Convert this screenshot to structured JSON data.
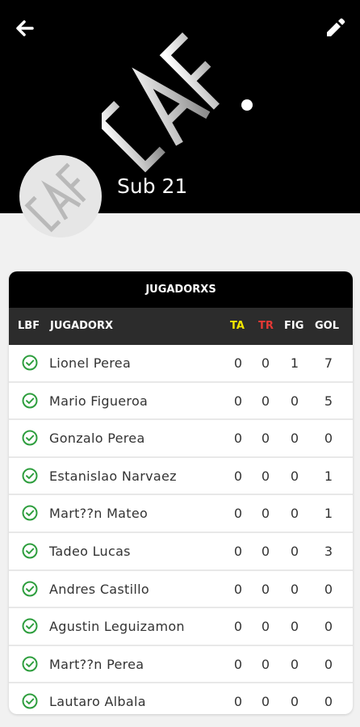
{
  "header": {
    "back_icon": "arrow-left-icon",
    "edit_icon": "pencil-icon",
    "team_name": "Sub 21",
    "logo_icon": "team-logo-icon"
  },
  "table": {
    "title": "JUGADORXS",
    "columns": {
      "lbf": "LBF",
      "player": "JUGADORX",
      "ta": "TA",
      "tr": "TR",
      "fig": "FIG",
      "gol": "GOL"
    },
    "colors": {
      "ta": "#f2e600",
      "tr": "#e53935",
      "check": "#2e9e3e"
    },
    "rows": [
      {
        "name": "Lionel Perea",
        "ta": "0",
        "tr": "0",
        "fig": "1",
        "gol": "7"
      },
      {
        "name": "Mario Figueroa",
        "ta": "0",
        "tr": "0",
        "fig": "0",
        "gol": "5"
      },
      {
        "name": "Gonzalo Perea",
        "ta": "0",
        "tr": "0",
        "fig": "0",
        "gol": "0"
      },
      {
        "name": "Estanislao Narvaez",
        "ta": "0",
        "tr": "0",
        "fig": "0",
        "gol": "1"
      },
      {
        "name": "Mart??n Mateo",
        "ta": "0",
        "tr": "0",
        "fig": "0",
        "gol": "1"
      },
      {
        "name": "Tadeo Lucas",
        "ta": "0",
        "tr": "0",
        "fig": "0",
        "gol": "3"
      },
      {
        "name": "Andres Castillo",
        "ta": "0",
        "tr": "0",
        "fig": "0",
        "gol": "0"
      },
      {
        "name": "Agustin Leguizamon",
        "ta": "0",
        "tr": "0",
        "fig": "0",
        "gol": "0"
      },
      {
        "name": "Mart??n Perea",
        "ta": "0",
        "tr": "0",
        "fig": "0",
        "gol": "0"
      },
      {
        "name": "Lautaro Albala",
        "ta": "0",
        "tr": "0",
        "fig": "0",
        "gol": "0"
      }
    ]
  }
}
